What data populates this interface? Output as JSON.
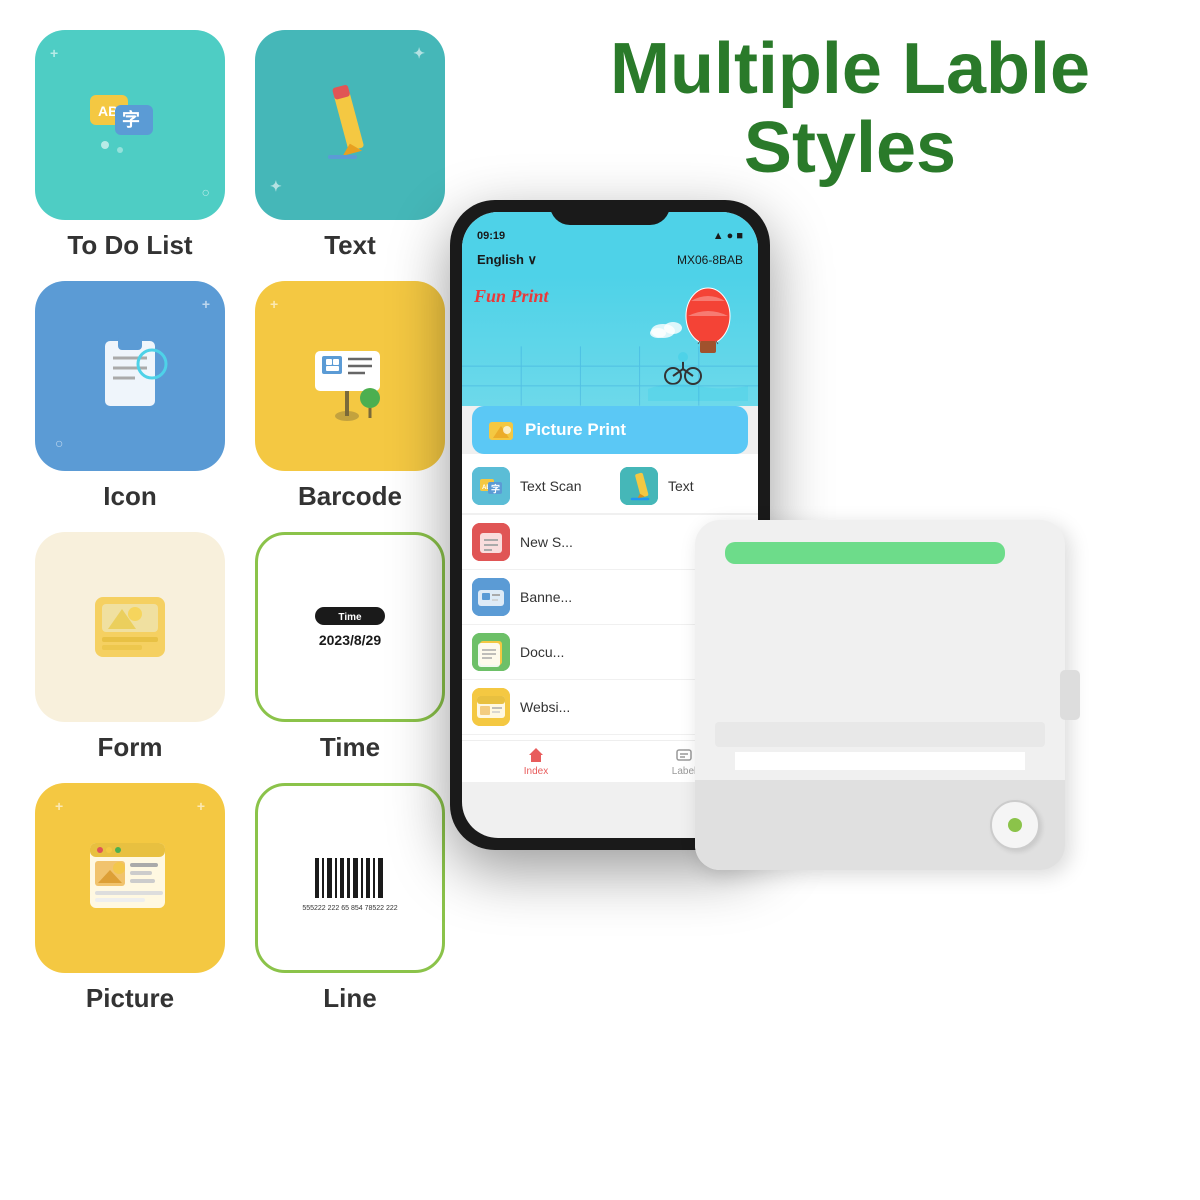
{
  "title": {
    "line1": "Multiple Lable",
    "line2": "Styles"
  },
  "grid": {
    "items": [
      {
        "id": "to-do-list",
        "label": "To Do List",
        "color": "teal"
      },
      {
        "id": "text",
        "label": "Text",
        "color": "teal2"
      },
      {
        "id": "icon",
        "label": "Icon",
        "color": "blue"
      },
      {
        "id": "barcode",
        "label": "Barcode",
        "color": "yellow"
      },
      {
        "id": "form",
        "label": "Form",
        "color": "cream"
      },
      {
        "id": "time",
        "label": "Time",
        "color": "white-border"
      },
      {
        "id": "picture",
        "label": "Picture",
        "color": "gold"
      },
      {
        "id": "line",
        "label": "Line",
        "color": "white-border2"
      }
    ]
  },
  "phone": {
    "time": "09:19",
    "language": "English ∨",
    "device_id": "MX06-8BAB",
    "banner_title": "Fun Print",
    "picture_print_label": "Picture Print",
    "menu_items": [
      {
        "id": "text-scan",
        "label": "Text Scan"
      },
      {
        "id": "text",
        "label": "Text"
      },
      {
        "id": "new",
        "label": "New S..."
      },
      {
        "id": "banner",
        "label": "Banne..."
      },
      {
        "id": "document",
        "label": "Docu..."
      },
      {
        "id": "website",
        "label": "Websi..."
      }
    ],
    "bottom_nav": [
      {
        "id": "index",
        "label": "Index",
        "active": true
      },
      {
        "id": "label",
        "label": "Label",
        "active": false
      }
    ]
  },
  "time_label": {
    "header": "Time",
    "value": "2023/8/29"
  }
}
